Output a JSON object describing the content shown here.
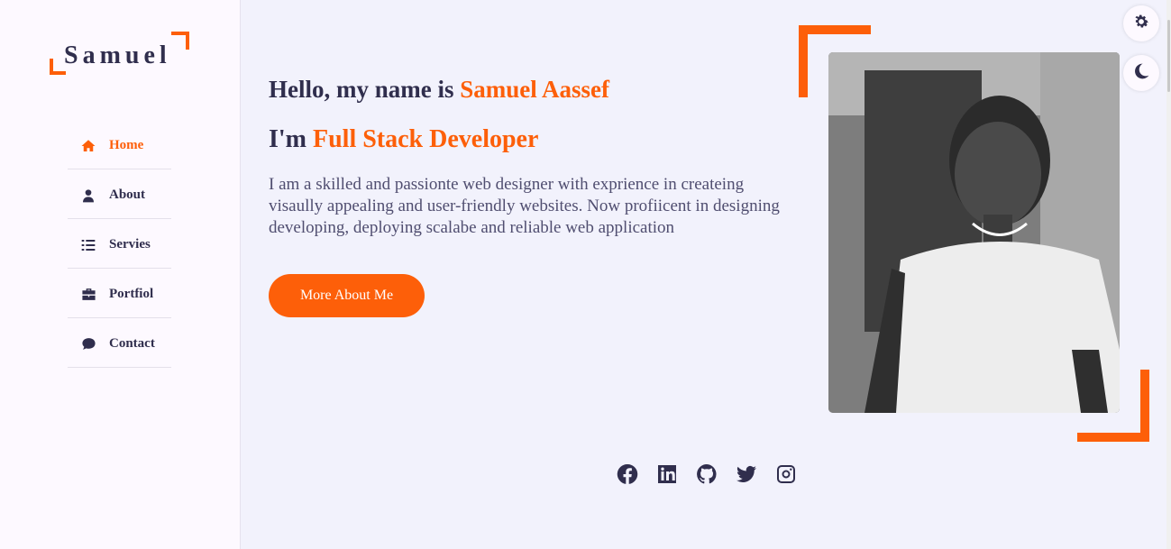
{
  "brand": {
    "logo_text": "Samuel",
    "accent_color": "#fd5f09",
    "text_color": "#302e4d"
  },
  "nav": {
    "items": [
      {
        "label": "Home",
        "icon": "home-icon",
        "active": true
      },
      {
        "label": "About",
        "icon": "user-icon"
      },
      {
        "label": "Servies",
        "icon": "list-icon"
      },
      {
        "label": "Portfiol",
        "icon": "briefcase-icon"
      },
      {
        "label": "Contact",
        "icon": "comment-icon"
      }
    ]
  },
  "hero": {
    "hello_prefix": "Hello, my name is ",
    "name": "Samuel Aassef",
    "role_prefix": "I'm ",
    "role": "Full Stack Developer",
    "description": "I am a skilled and passionte web designer with exprience in createing visaully appealing and user-friendly websites. Now profiicent in designing developing, deploying scalabe and reliable web application",
    "button_label": "More About Me"
  },
  "social": [
    "facebook-icon",
    "linkedin-icon",
    "github-icon",
    "twitter-icon",
    "instagram-icon"
  ],
  "toggles": [
    "gear-icon",
    "moon-icon"
  ]
}
